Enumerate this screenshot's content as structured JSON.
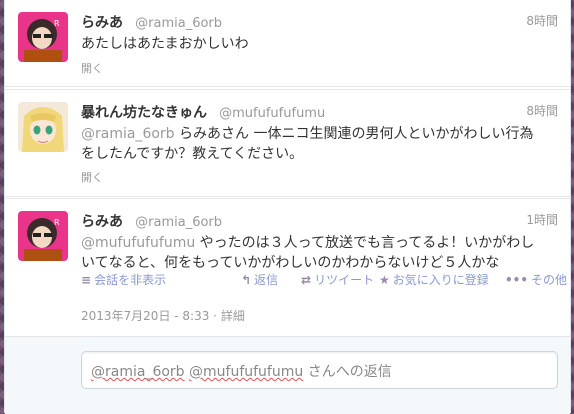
{
  "tweets": [
    {
      "name": "らみあ",
      "handle": "@ramia_6orb",
      "time": "8時間",
      "text": "あたしはあたまおかしいわ",
      "expand": "開く"
    },
    {
      "name": "暴れん坊たなきゅん",
      "handle": "@mufufufufumu",
      "time": "8時間",
      "mention": "@ramia_6orb",
      "text_line1": " らみあさん 一体ニコ生関連の男何人といかがわしい行為",
      "text_line2": "をしたんですか？教えてください。",
      "expand": "開く"
    },
    {
      "name": "らみあ",
      "handle": "@ramia_6orb",
      "time": "1時間",
      "mention": "@mufufufufumu",
      "text_line1": " やったのは３人って放送でも言ってるよ！いかがわし",
      "text_line2": "いてなると、何をもっていかがわしいのかわからないけど５人かな",
      "actions": {
        "hide": "会話を非表示",
        "reply": "返信",
        "retweet": "リツイート",
        "favorite": "お気に入りに登録",
        "more": "その他"
      },
      "timestamp": "2013年7月20日 - 8:33",
      "separator": " · ",
      "detail": "詳細"
    }
  ],
  "reply_box": {
    "mention1": "@ramia_6orb",
    "mention2": "@mufufufufumu",
    "suffix": " さんへの返信"
  },
  "icons": {
    "hide": "≡",
    "reply": "↰",
    "retweet": "⇄",
    "favorite": "★",
    "more": "•••"
  }
}
